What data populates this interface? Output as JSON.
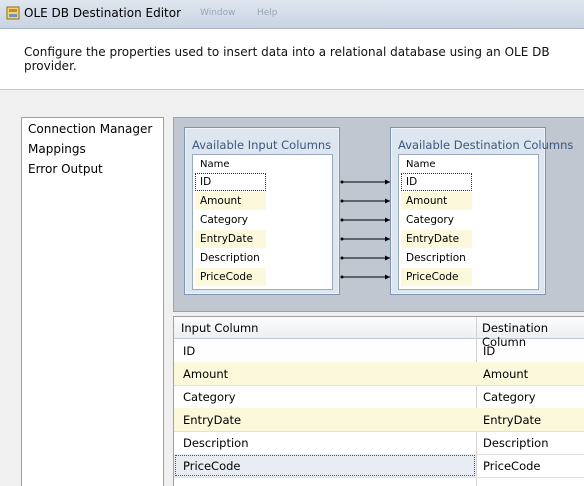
{
  "window": {
    "title": "OLE DB Destination Editor",
    "ghost_menu": [
      "Window",
      "Help"
    ]
  },
  "header": {
    "description": "Configure the properties used to insert data into a relational database using an OLE DB provider."
  },
  "sidebar": {
    "items": [
      {
        "label": "Connection Manager"
      },
      {
        "label": "Mappings"
      },
      {
        "label": "Error Output"
      }
    ]
  },
  "diagram": {
    "input_box": {
      "title": "Available Input Columns",
      "header": "Name",
      "columns": [
        "ID",
        "Amount",
        "Category",
        "EntryDate",
        "Description",
        "PriceCode"
      ]
    },
    "destination_box": {
      "title": "Available Destination Columns",
      "header": "Name",
      "columns": [
        "ID",
        "Amount",
        "Category",
        "EntryDate",
        "Description",
        "PriceCode"
      ]
    }
  },
  "grid": {
    "headers": {
      "input": "Input Column",
      "destination": "Destination Column"
    },
    "rows": [
      {
        "input": "ID",
        "destination": "ID"
      },
      {
        "input": "Amount",
        "destination": "Amount"
      },
      {
        "input": "Category",
        "destination": "Category"
      },
      {
        "input": "EntryDate",
        "destination": "EntryDate"
      },
      {
        "input": "Description",
        "destination": "Description"
      },
      {
        "input": "PriceCode",
        "destination": "PriceCode"
      }
    ]
  },
  "colors": {
    "alt_row": "#fbf8dc",
    "box_title": "#3a5880",
    "diagram_bg": "#c0c7d0"
  }
}
